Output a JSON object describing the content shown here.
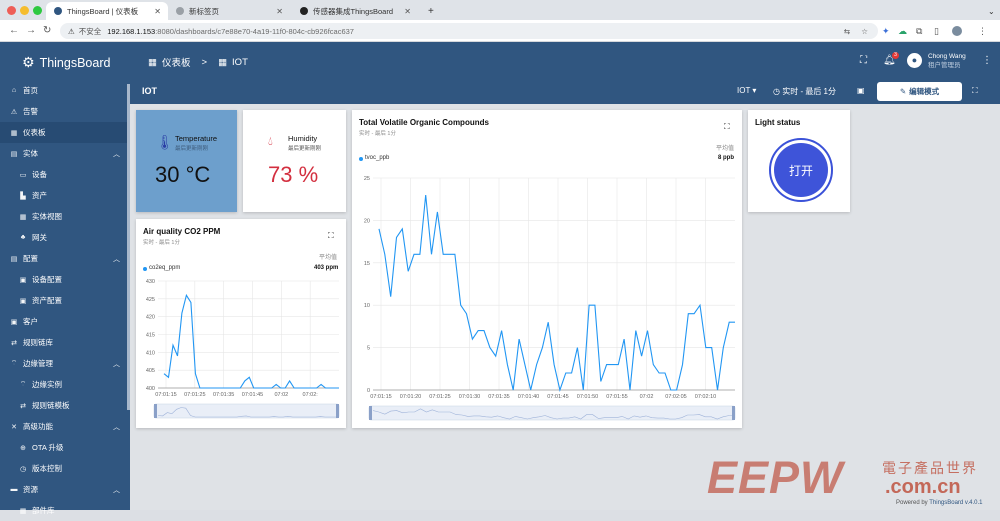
{
  "browser": {
    "tabs": [
      {
        "title": "ThingsBoard | 仪表板",
        "active": true
      },
      {
        "title": "新标签页",
        "active": false
      },
      {
        "title": "传感器集成ThingsBoard",
        "active": false
      }
    ],
    "new_tab": "+",
    "insecure_label": "不安全",
    "url_host": "192.168.1.153",
    "url_path": ":8080/dashboards/c7e88e70-4a19-11f0-804c-cb926fcac637"
  },
  "sidebar": {
    "brand": "ThingsBoard",
    "items": [
      {
        "label": "首页",
        "icon": "home-icon",
        "glyph": "⌂"
      },
      {
        "label": "告警",
        "icon": "alarm-icon",
        "glyph": "⚠"
      },
      {
        "label": "仪表板",
        "icon": "dashboard-icon",
        "glyph": "▦"
      },
      {
        "label": "实体",
        "icon": "entity-icon",
        "glyph": "▤"
      },
      {
        "label": "设备",
        "icon": "device-icon",
        "glyph": "▭"
      },
      {
        "label": "资产",
        "icon": "asset-icon",
        "glyph": "▙"
      },
      {
        "label": "实体视图",
        "icon": "entity-view-icon",
        "glyph": "▦"
      },
      {
        "label": "网关",
        "icon": "gateway-icon",
        "glyph": "♣"
      },
      {
        "label": "配置",
        "icon": "config-icon",
        "glyph": "▤"
      },
      {
        "label": "设备配置",
        "icon": "device-profile-icon",
        "glyph": "▣"
      },
      {
        "label": "资产配置",
        "icon": "asset-profile-icon",
        "glyph": "▣"
      },
      {
        "label": "客户",
        "icon": "customer-icon",
        "glyph": "▣"
      },
      {
        "label": "规则链库",
        "icon": "rule-chain-icon",
        "glyph": "⇄"
      },
      {
        "label": "边缘管理",
        "icon": "edge-icon",
        "glyph": "⌔"
      },
      {
        "label": "边缘实例",
        "icon": "edge-instance-icon",
        "glyph": "⌔"
      },
      {
        "label": "规则链模板",
        "icon": "rule-template-icon",
        "glyph": "⇄"
      },
      {
        "label": "高级功能",
        "icon": "advanced-icon",
        "glyph": "✕"
      },
      {
        "label": "OTA 升级",
        "icon": "ota-icon",
        "glyph": "⊕"
      },
      {
        "label": "版本控制",
        "icon": "version-icon",
        "glyph": "◷"
      },
      {
        "label": "资源",
        "icon": "resource-icon",
        "glyph": "▬"
      },
      {
        "label": "部件库",
        "icon": "widget-library-icon",
        "glyph": "▦"
      }
    ]
  },
  "topbar": {
    "crumb_dashboards": "仪表板",
    "crumb_sep": ">",
    "crumb_current": "IOT",
    "notification_count": "3",
    "user_name": "Chong Wang",
    "user_role": "租户管理员"
  },
  "dashboard": {
    "title": "IOT",
    "state": "IOT",
    "timewindow": "实时 - 最后 1分",
    "edit_button": "编辑模式"
  },
  "widgets": {
    "temperature": {
      "title": "Temperature",
      "sub": "最后更新刚刚",
      "value": "30 °C"
    },
    "humidity": {
      "title": "Humidity",
      "sub": "最后更新刚刚",
      "value": "73 %",
      "value_color": "#d32f3f"
    },
    "co2": {
      "title": "Air quality CO2 PPM",
      "sub": "实时 - 最后 1分",
      "avg_label": "平均值",
      "series": "co2eq_ppm",
      "avg_value": "403 ppm"
    },
    "voc": {
      "title": "Total Volatile Organic Compounds",
      "sub": "实时 - 最后 1分",
      "avg_label": "平均值",
      "series": "tvoc_ppb",
      "avg_value": "8 ppb"
    },
    "light": {
      "title": "Light status",
      "button": "打开"
    }
  },
  "chart_data": [
    {
      "type": "line",
      "title": "Air quality CO2 PPM",
      "series": [
        {
          "name": "co2eq_ppm",
          "color": "#2196f3",
          "values": [
            404,
            403,
            412,
            409,
            421,
            426,
            424,
            404,
            400,
            400,
            400,
            400,
            400,
            400,
            400,
            400,
            400,
            400,
            402,
            403,
            400,
            400,
            400,
            400,
            400,
            401,
            400,
            400,
            402,
            400,
            400,
            400,
            400,
            400,
            400,
            401,
            400,
            400,
            400,
            400
          ]
        }
      ],
      "x_ticks": [
        "07:01:15",
        "07:01:25",
        "07:01:35",
        "07:01:45",
        "07:02",
        "07:02:"
      ],
      "y_ticks": [
        400,
        405,
        410,
        415,
        420,
        425,
        430
      ],
      "ylim": [
        400,
        430
      ]
    },
    {
      "type": "line",
      "title": "Total Volatile Organic Compounds",
      "series": [
        {
          "name": "tvoc_ppb",
          "color": "#2196f3",
          "values": [
            19,
            16,
            11,
            18,
            19,
            14,
            16,
            16,
            23,
            16,
            21,
            16,
            16,
            16,
            10,
            9,
            6,
            7,
            7,
            5,
            4,
            7,
            3,
            0,
            6,
            3,
            0,
            3,
            5,
            8,
            3,
            0,
            2,
            2,
            5,
            0,
            10,
            10,
            1,
            3,
            3,
            3,
            6,
            0,
            7,
            4,
            7,
            3,
            2,
            2,
            0,
            0,
            3,
            9,
            9,
            10,
            5,
            5,
            0,
            5,
            8,
            8
          ]
        }
      ],
      "x_ticks": [
        "07:01:15",
        "07:01:20",
        "07:01:25",
        "07:01:30",
        "07:01:35",
        "07:01:40",
        "07:01:45",
        "07:01:50",
        "07:01:55",
        "07:02",
        "07:02:05",
        "07:02:10"
      ],
      "y_ticks": [
        0,
        5,
        10,
        15,
        20,
        25
      ],
      "ylim": [
        0,
        25
      ]
    }
  ],
  "watermark": {
    "brand": "EEPW",
    "cn": "電子產品世界",
    "domain": ".com.cn"
  },
  "powered_prefix": "Powered by ",
  "powered_brand": "ThingsBoard v.4.0.1"
}
